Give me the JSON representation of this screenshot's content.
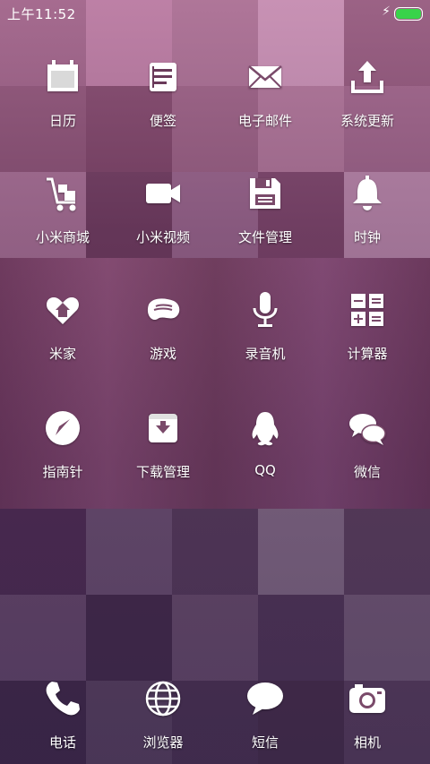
{
  "status_bar": {
    "time": "上午11:52",
    "charging_icon": "bolt-icon",
    "battery_color": "#39d34a"
  },
  "wallpaper": {
    "tint": "#5a2f4c"
  },
  "apps": [
    {
      "label": "日历",
      "icon": "calendar-icon"
    },
    {
      "label": "便签",
      "icon": "notes-icon"
    },
    {
      "label": "电子邮件",
      "icon": "envelope-icon"
    },
    {
      "label": "系统更新",
      "icon": "upload-icon"
    },
    {
      "label": "小米商城",
      "icon": "cart-icon"
    },
    {
      "label": "小米视频",
      "icon": "video-camera-icon"
    },
    {
      "label": "文件管理",
      "icon": "floppy-disk-icon"
    },
    {
      "label": "时钟",
      "icon": "bell-icon"
    },
    {
      "label": "米家",
      "icon": "heart-home-icon"
    },
    {
      "label": "游戏",
      "icon": "gamepad-icon"
    },
    {
      "label": "录音机",
      "icon": "microphone-icon"
    },
    {
      "label": "计算器",
      "icon": "calculator-icon"
    },
    {
      "label": "指南针",
      "icon": "compass-icon"
    },
    {
      "label": "下载管理",
      "icon": "download-box-icon"
    },
    {
      "label": "QQ",
      "icon": "penguin-icon"
    },
    {
      "label": "微信",
      "icon": "chat-bubbles-icon"
    }
  ],
  "dock": [
    {
      "label": "电话",
      "icon": "phone-icon"
    },
    {
      "label": "浏览器",
      "icon": "globe-icon"
    },
    {
      "label": "短信",
      "icon": "message-bubble-icon"
    },
    {
      "label": "相机",
      "icon": "camera-icon"
    }
  ]
}
